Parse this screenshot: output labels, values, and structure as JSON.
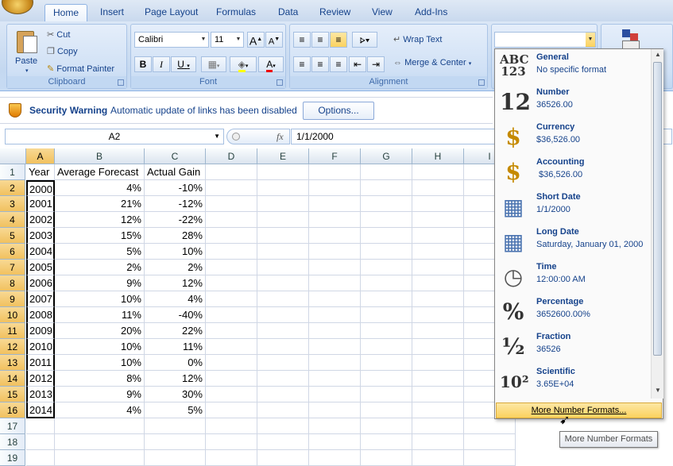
{
  "ribbon_tabs": [
    "Home",
    "Insert",
    "Page Layout",
    "Formulas",
    "Data",
    "Review",
    "View",
    "Add-Ins"
  ],
  "clipboard": {
    "paste": "Paste",
    "cut": "Cut",
    "copy": "Copy",
    "format_painter": "Format Painter",
    "group_label": "Clipboard"
  },
  "font": {
    "name": "Calibri",
    "size": "11",
    "group_label": "Font",
    "bold": "B",
    "italic": "I",
    "underline": "U",
    "grow": "A",
    "shrink": "A",
    "color_letter": "A"
  },
  "alignment": {
    "wrap_text": "Wrap Text",
    "merge_center": "Merge & Center",
    "group_label": "Alignment"
  },
  "number_format_value": "",
  "security": {
    "title": "Security Warning",
    "message": "Automatic update of links has been disabled",
    "options_button": "Options..."
  },
  "formula_bar": {
    "name_box": "A2",
    "fx": "fx",
    "formula": "1/1/2000"
  },
  "columns": [
    "A",
    "B",
    "C",
    "D",
    "E",
    "F",
    "G",
    "H",
    "I"
  ],
  "row_numbers": [
    "1",
    "2",
    "3",
    "4",
    "5",
    "6",
    "7",
    "8",
    "9",
    "10",
    "11",
    "12",
    "13",
    "14",
    "15",
    "16",
    "17",
    "18",
    "19"
  ],
  "table_header": [
    "Year",
    "Average Forecast",
    "Actual Gain"
  ],
  "table_rows": [
    [
      "2000",
      "4%",
      "-10%"
    ],
    [
      "2001",
      "21%",
      "-12%"
    ],
    [
      "2002",
      "12%",
      "-22%"
    ],
    [
      "2003",
      "15%",
      "28%"
    ],
    [
      "2004",
      "5%",
      "10%"
    ],
    [
      "2005",
      "2%",
      "2%"
    ],
    [
      "2006",
      "9%",
      "12%"
    ],
    [
      "2007",
      "10%",
      "4%"
    ],
    [
      "2008",
      "11%",
      "-40%"
    ],
    [
      "2009",
      "20%",
      "22%"
    ],
    [
      "2010",
      "10%",
      "11%"
    ],
    [
      "2011",
      "10%",
      "0%"
    ],
    [
      "2012",
      "8%",
      "12%"
    ],
    [
      "2013",
      "9%",
      "30%"
    ],
    [
      "2014",
      "4%",
      "5%"
    ]
  ],
  "number_formats": [
    {
      "name": "General",
      "example": "No specific format",
      "icon": "abc-123-icon",
      "glyph": "ABC\n123"
    },
    {
      "name": "Number",
      "example": "36526.00",
      "icon": "number-12-icon",
      "glyph": "12"
    },
    {
      "name": "Currency",
      "example": "$36,526.00",
      "icon": "currency-icon",
      "glyph": "$"
    },
    {
      "name": "Accounting",
      "example": " $36,526.00",
      "icon": "accounting-icon",
      "glyph": "$"
    },
    {
      "name": "Short Date",
      "example": "1/1/2000",
      "icon": "calendar-icon",
      "glyph": "▦"
    },
    {
      "name": "Long Date",
      "example": "Saturday, January 01, 2000",
      "icon": "calendar-icon",
      "glyph": "▦"
    },
    {
      "name": "Time",
      "example": "12:00:00 AM",
      "icon": "clock-icon",
      "glyph": "◷"
    },
    {
      "name": "Percentage",
      "example": "3652600.00%",
      "icon": "percent-icon",
      "glyph": "%"
    },
    {
      "name": "Fraction",
      "example": "36526",
      "icon": "fraction-icon",
      "glyph": "½"
    },
    {
      "name": "Scientific",
      "example": "3.65E+04",
      "icon": "scientific-icon",
      "glyph": "10²"
    }
  ],
  "more_formats": "More Number Formats...",
  "tooltip": "More Number Formats"
}
